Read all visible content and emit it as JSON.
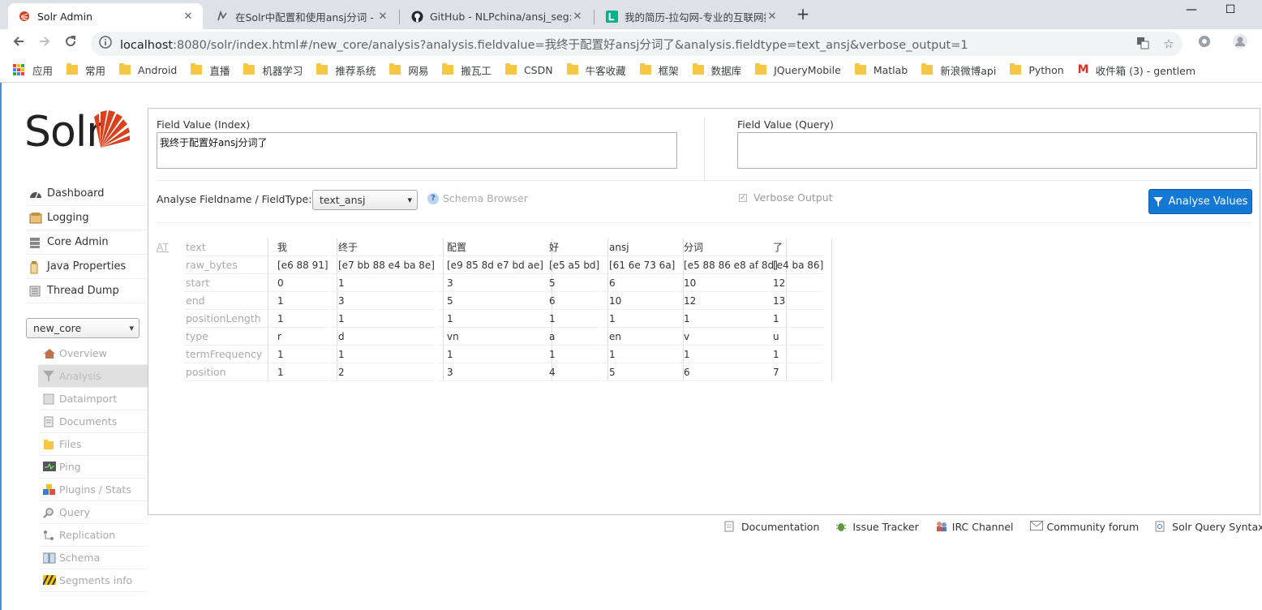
{
  "browser": {
    "tabs": [
      {
        "title": "Solr Admin",
        "active": true
      },
      {
        "title": "在Solr中配置和使用ansj分词 - 零",
        "active": false
      },
      {
        "title": "GitHub - NLPchina/ansj_seg: a",
        "active": false
      },
      {
        "title": "我的简历-拉勾网-专业的互联网招",
        "active": false
      }
    ],
    "close_glyph": "✕",
    "new_tab_glyph": "+",
    "url_host": "localhost",
    "url_rest": ":8080/solr/index.html#/new_core/analysis?analysis.fieldvalue=我终于配置好ansj分词了&analysis.fieldtype=text_ansj&verbose_output=1",
    "bookmarks": [
      {
        "label": "应用",
        "icon": "apps-grid-icon"
      },
      {
        "label": "常用",
        "icon": "folder-icon"
      },
      {
        "label": "Android",
        "icon": "folder-icon"
      },
      {
        "label": "直播",
        "icon": "folder-icon"
      },
      {
        "label": "机器学习",
        "icon": "folder-icon"
      },
      {
        "label": "推荐系统",
        "icon": "folder-icon"
      },
      {
        "label": "网易",
        "icon": "folder-icon"
      },
      {
        "label": "搬瓦工",
        "icon": "folder-icon"
      },
      {
        "label": "CSDN",
        "icon": "folder-icon"
      },
      {
        "label": "牛客收藏",
        "icon": "folder-icon"
      },
      {
        "label": "框架",
        "icon": "folder-icon"
      },
      {
        "label": "数据库",
        "icon": "folder-icon"
      },
      {
        "label": "JQueryMobile",
        "icon": "folder-icon"
      },
      {
        "label": "Matlab",
        "icon": "folder-icon"
      },
      {
        "label": "新浪微博api",
        "icon": "folder-icon"
      },
      {
        "label": "Python",
        "icon": "folder-icon"
      },
      {
        "label": "收件箱 (3) - gentlem",
        "icon": "gmail-icon"
      }
    ]
  },
  "solr": {
    "logo_text": "Solr",
    "nav": [
      {
        "label": "Dashboard",
        "icon": "dashboard-icon"
      },
      {
        "label": "Logging",
        "icon": "logging-icon"
      },
      {
        "label": "Core Admin",
        "icon": "core-admin-icon"
      },
      {
        "label": "Java Properties",
        "icon": "java-icon"
      },
      {
        "label": "Thread Dump",
        "icon": "thread-dump-icon"
      }
    ],
    "core_selector": "new_core",
    "core_menu": [
      {
        "label": "Overview",
        "icon": "overview-icon",
        "active": false
      },
      {
        "label": "Analysis",
        "icon": "analysis-icon",
        "active": true
      },
      {
        "label": "Dataimport",
        "icon": "dataimport-icon",
        "active": false
      },
      {
        "label": "Documents",
        "icon": "documents-icon",
        "active": false
      },
      {
        "label": "Files",
        "icon": "files-icon",
        "active": false
      },
      {
        "label": "Ping",
        "icon": "ping-icon",
        "active": false
      },
      {
        "label": "Plugins / Stats",
        "icon": "plugins-icon",
        "active": false
      },
      {
        "label": "Query",
        "icon": "query-icon",
        "active": false
      },
      {
        "label": "Replication",
        "icon": "replication-icon",
        "active": false
      },
      {
        "label": "Schema",
        "icon": "schema-icon",
        "active": false
      },
      {
        "label": "Segments info",
        "icon": "segments-icon",
        "active": false
      }
    ],
    "analysis": {
      "field_value_index_label": "Field Value (Index)",
      "field_value_index": "我终于配置好ansj分词了",
      "field_value_query_label": "Field Value (Query)",
      "field_value_query": "",
      "fieldtype_label": "Analyse Fieldname / FieldType:",
      "fieldtype_value": "text_ansj",
      "schema_browser": "Schema Browser",
      "verbose_output": "Verbose Output",
      "verbose_checked": true,
      "analyse_button": "Analyse Values",
      "at_label": "AT",
      "attributes": [
        "text",
        "raw_bytes",
        "start",
        "end",
        "positionLength",
        "type",
        "termFrequency",
        "position"
      ],
      "tokens": [
        [
          "我",
          "[e6 88 91]",
          "0",
          "1",
          "1",
          "r",
          "1",
          "1"
        ],
        [
          "终于",
          "[e7 bb 88 e4 ba 8e]",
          "1",
          "3",
          "1",
          "d",
          "1",
          "2"
        ],
        [
          "配置",
          "[e9 85 8d e7 bd ae]",
          "3",
          "5",
          "1",
          "vn",
          "1",
          "3"
        ],
        [
          "好",
          "[e5 a5 bd]",
          "5",
          "6",
          "1",
          "a",
          "1",
          "4"
        ],
        [
          "ansj",
          "[61 6e 73 6a]",
          "6",
          "10",
          "1",
          "en",
          "1",
          "5"
        ],
        [
          "分词",
          "[e5 88 86 e8 af 8d]",
          "10",
          "12",
          "1",
          "v",
          "1",
          "6"
        ],
        [
          "了",
          "[e4 ba 86]",
          "12",
          "13",
          "1",
          "u",
          "1",
          "7"
        ]
      ]
    },
    "footer": [
      {
        "label": "Documentation",
        "icon": "documentation-icon"
      },
      {
        "label": "Issue Tracker",
        "icon": "bug-icon"
      },
      {
        "label": "IRC Channel",
        "icon": "irc-icon"
      },
      {
        "label": "Community forum",
        "icon": "mail-icon"
      },
      {
        "label": "Solr Query Syntax",
        "icon": "query-syntax-icon"
      }
    ]
  },
  "colors": {
    "accent": "#1578d4",
    "solr_red": "#d9411e"
  }
}
